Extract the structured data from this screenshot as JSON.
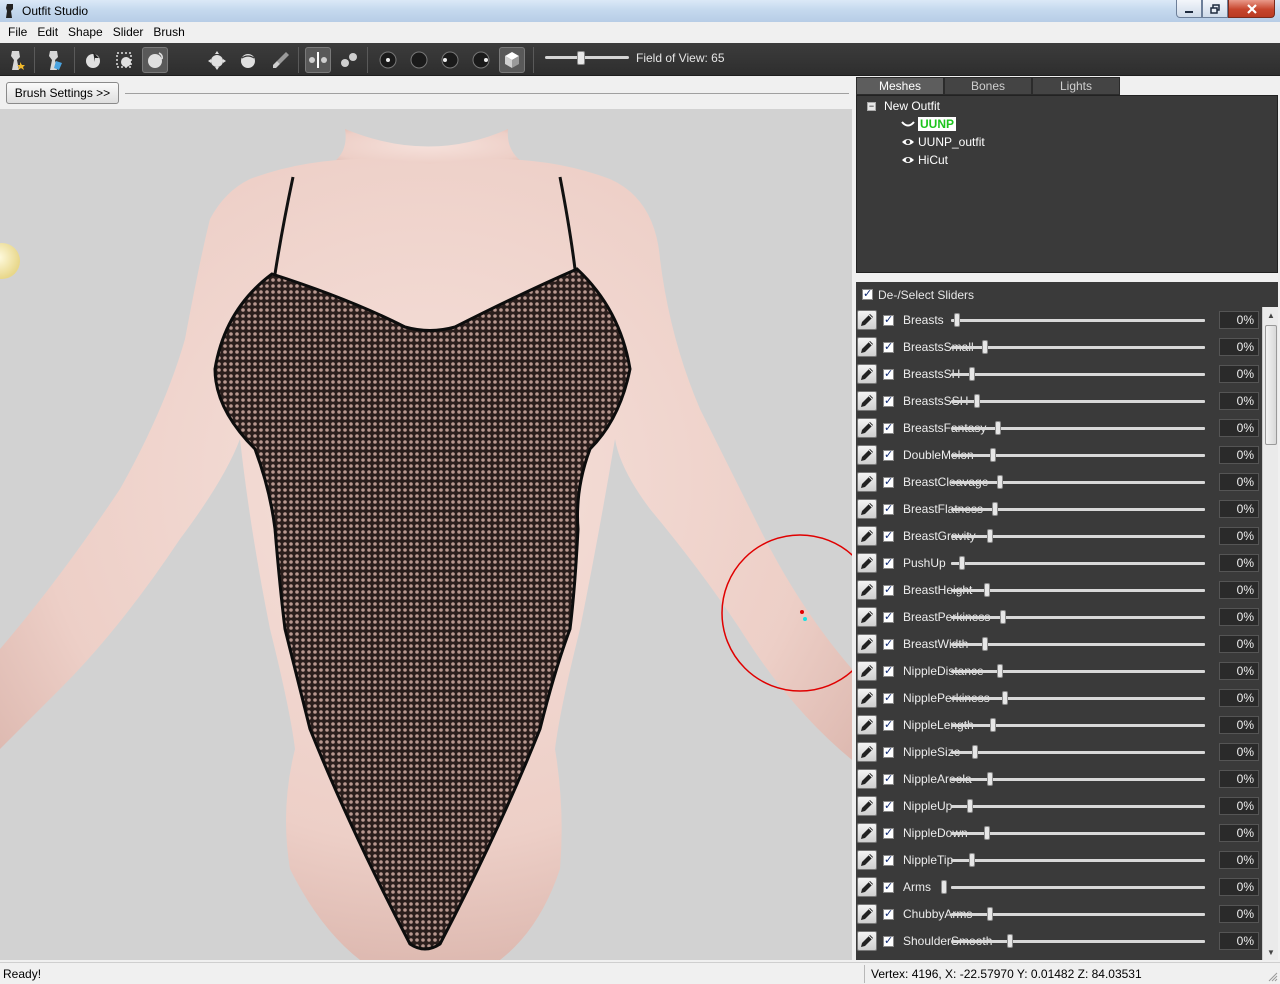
{
  "window": {
    "title": "Outfit Studio"
  },
  "menubar": [
    "File",
    "Edit",
    "Shape",
    "Slider",
    "Brush"
  ],
  "toolbar": {
    "fov_label": "Field of View: 65",
    "fov_value": 65
  },
  "brush_settings_label": "Brush Settings >>",
  "tabs": [
    {
      "label": "Meshes",
      "active": true
    },
    {
      "label": "Bones",
      "active": false
    },
    {
      "label": "Lights",
      "active": false
    }
  ],
  "tree": {
    "root": "New Outfit",
    "items": [
      {
        "label": "UUNP",
        "selected": true
      },
      {
        "label": "UUNP_outfit",
        "selected": false
      },
      {
        "label": "HiCut",
        "selected": false
      }
    ]
  },
  "deselect_label": "De-/Select Sliders",
  "sliders": [
    {
      "name": "Breasts",
      "value": "0%",
      "level": 0.0
    },
    {
      "name": "BreastsSmall",
      "value": "0%",
      "level": 0.11
    },
    {
      "name": "BreastsSH",
      "value": "0%",
      "level": 0.06
    },
    {
      "name": "BreastsSSH",
      "value": "0%",
      "level": 0.08
    },
    {
      "name": "BreastsFantasy",
      "value": "0%",
      "level": 0.16
    },
    {
      "name": "DoubleMelon",
      "value": "0%",
      "level": 0.14
    },
    {
      "name": "BreastCleavage",
      "value": "0%",
      "level": 0.17
    },
    {
      "name": "BreastFlatness",
      "value": "0%",
      "level": 0.15
    },
    {
      "name": "BreastGravity",
      "value": "0%",
      "level": 0.13
    },
    {
      "name": "PushUp",
      "value": "0%",
      "level": 0.02
    },
    {
      "name": "BreastHeight",
      "value": "0%",
      "level": 0.12
    },
    {
      "name": "BreastPerkiness",
      "value": "0%",
      "level": 0.18
    },
    {
      "name": "BreastWidth",
      "value": "0%",
      "level": 0.11
    },
    {
      "name": "NippleDistance",
      "value": "0%",
      "level": 0.17
    },
    {
      "name": "NipplePerkiness",
      "value": "0%",
      "level": 0.19
    },
    {
      "name": "NippleLength",
      "value": "0%",
      "level": 0.14
    },
    {
      "name": "NippleSize",
      "value": "0%",
      "level": 0.07
    },
    {
      "name": "NippleAreola",
      "value": "0%",
      "level": 0.13
    },
    {
      "name": "NippleUp",
      "value": "0%",
      "level": 0.05
    },
    {
      "name": "NippleDown",
      "value": "0%",
      "level": 0.12
    },
    {
      "name": "NippleTip",
      "value": "0%",
      "level": 0.06
    },
    {
      "name": "Arms",
      "value": "0%",
      "level": -0.05
    },
    {
      "name": "ChubbyArms",
      "value": "0%",
      "level": 0.13
    },
    {
      "name": "ShoulderSmooth",
      "value": "0%",
      "level": 0.21
    }
  ],
  "status": {
    "left": "Ready!",
    "right": "Vertex: 4196, X: -22.57970 Y: 0.01482 Z: 84.03531"
  }
}
